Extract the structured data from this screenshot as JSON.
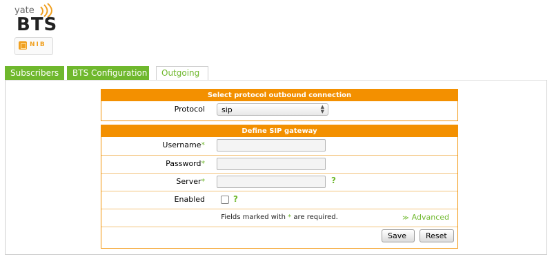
{
  "logo": {
    "yate": "yate",
    "bts": "BTS",
    "nib": "NIB"
  },
  "tabs": [
    {
      "label": "Subscribers"
    },
    {
      "label": "BTS Configuration"
    },
    {
      "label": "Outgoing"
    }
  ],
  "protocol_section": {
    "title": "Select protocol outbound connection",
    "protocol_label": "Protocol",
    "protocol_value": "sip"
  },
  "sip_section": {
    "title": "Define SIP gateway",
    "username_label": "Username",
    "password_label": "Password",
    "server_label": "Server",
    "enabled_label": "Enabled",
    "required_mark": "*",
    "help_mark": "?",
    "note_prefix": "Fields marked with ",
    "note_suffix": " are required.",
    "advanced_label": "Advanced",
    "save_label": "Save",
    "reset_label": "Reset",
    "enabled_checked": false
  },
  "colors": {
    "accent_green": "#6fb82d",
    "accent_orange": "#f39000"
  },
  "icons": {
    "advanced": "double-chevron-down-icon"
  }
}
